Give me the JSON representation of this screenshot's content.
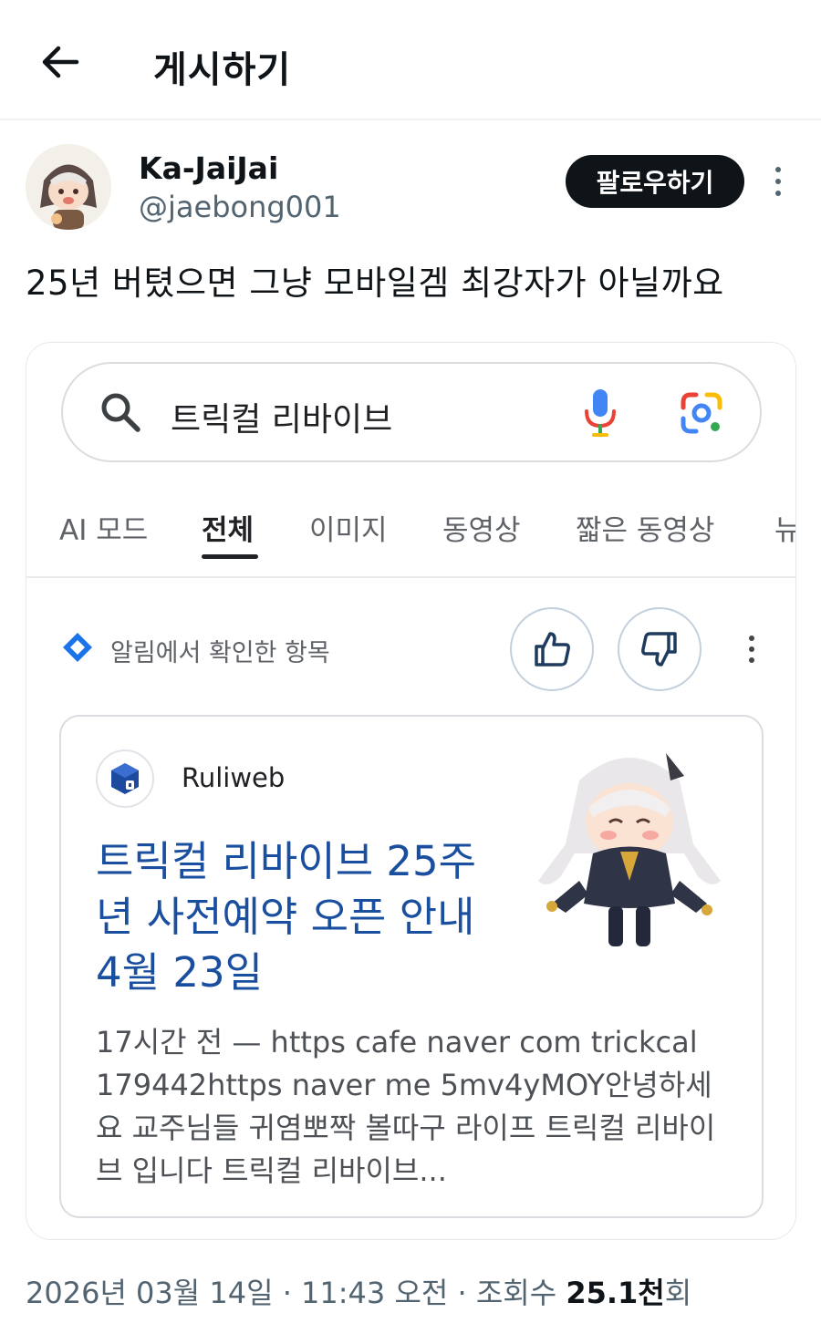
{
  "header": {
    "title": "게시하기",
    "back_icon": "arrow-left-icon"
  },
  "author": {
    "display_name": "Ka-JaiJai",
    "handle": "@jaebong001",
    "follow_label": "팔로우하기",
    "more_icon": "more-vertical-icon"
  },
  "tweet": {
    "text": "25년 버텼으면 그냥 모바일겜 최강자가 아닐까요"
  },
  "screenshot": {
    "search": {
      "query": "트릭컬 리바이브",
      "search_icon": "search-icon",
      "mic_icon": "mic-icon",
      "lens_icon": "google-lens-icon"
    },
    "tabs": [
      {
        "label": "AI 모드",
        "active": false
      },
      {
        "label": "전체",
        "active": true
      },
      {
        "label": "이미지",
        "active": false
      },
      {
        "label": "동영상",
        "active": false
      },
      {
        "label": "짧은 동영상",
        "active": false
      },
      {
        "label": "뉴",
        "active": false
      }
    ],
    "notice": {
      "text": "알림에서 확인한 항목",
      "icon": "diamond-sparkle-icon",
      "thumbs_up_icon": "thumbs-up-icon",
      "thumbs_down_icon": "thumbs-down-icon",
      "more_icon": "more-vertical-icon"
    },
    "result": {
      "site_name": "Ruliweb",
      "site_icon": "ruliweb-logo-icon",
      "title": "트릭컬 리바이브 25주년 사전예약 오픈 안내 4월 23일",
      "snippet": "17시간 전 — https cafe naver com trickcal 179442https naver me 5mv4yMOY안녕하세요 교주님들 귀염뽀짝 볼따구 라이프 트릭컬 리바이브 입니다 트릭컬 리바이브...",
      "thumbnail": "anime-character-illustration",
      "title_color": "#1a4fa0"
    }
  },
  "meta": {
    "date": "2026년 03월 14일 · 11:43 오전 · 조회수 ",
    "views": "25.1천",
    "views_suffix": "회"
  },
  "colors": {
    "text": "#0f1419",
    "muted": "#536471",
    "follow_bg": "#0f1419",
    "link": "#1a4fa0"
  }
}
